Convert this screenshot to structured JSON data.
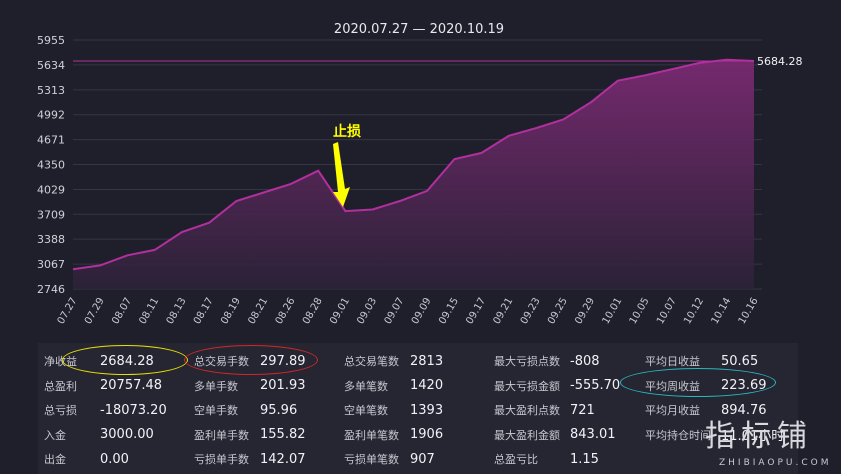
{
  "chart_data": {
    "type": "area",
    "title": "2020.07.27 — 2020.10.19",
    "x": [
      "07.27",
      "07.29",
      "08.07",
      "08.11",
      "08.13",
      "08.17",
      "08.19",
      "08.21",
      "08.26",
      "08.28",
      "09.01",
      "09.03",
      "09.07",
      "09.09",
      "09.15",
      "09.17",
      "09.21",
      "09.23",
      "09.25",
      "09.29",
      "10.01",
      "10.05",
      "10.07",
      "10.12",
      "10.14",
      "10.16"
    ],
    "y": [
      3000,
      3050,
      3180,
      3250,
      3480,
      3600,
      3880,
      3990,
      4100,
      4270,
      3750,
      3770,
      3880,
      4010,
      4420,
      4500,
      4720,
      4820,
      4930,
      5150,
      5430,
      5500,
      5580,
      5660,
      5700,
      5684.28
    ],
    "ylim": [
      2746,
      5955
    ],
    "yticks": [
      2746,
      3067,
      3388,
      3709,
      4029,
      4350,
      4671,
      4992,
      5313,
      5634,
      5955
    ],
    "last_value_label": "5684.28",
    "color": "#b1309e",
    "annotation": {
      "text": "止损",
      "color": "#ffff00",
      "at_x": "09.01"
    }
  },
  "stats": {
    "col1": [
      {
        "label": "净收益",
        "value": "2684.28"
      },
      {
        "label": "总盈利",
        "value": "20757.48"
      },
      {
        "label": "总亏损",
        "value": "-18073.20"
      },
      {
        "label": "入金",
        "value": "3000.00"
      },
      {
        "label": "出金",
        "value": "0.00"
      }
    ],
    "col2": [
      {
        "label": "总交易手数",
        "value": "297.89"
      },
      {
        "label": "多单手数",
        "value": "201.93"
      },
      {
        "label": "空单手数",
        "value": "95.96"
      },
      {
        "label": "盈利单手数",
        "value": "155.82"
      },
      {
        "label": "亏损单手数",
        "value": "142.07"
      }
    ],
    "col3": [
      {
        "label": "总交易笔数",
        "value": "2813"
      },
      {
        "label": "多单笔数",
        "value": "1420"
      },
      {
        "label": "空单笔数",
        "value": "1393"
      },
      {
        "label": "盈利单笔数",
        "value": "1906"
      },
      {
        "label": "亏损单笔数",
        "value": "907"
      }
    ],
    "col4": [
      {
        "label": "最大亏损点数",
        "value": "-808"
      },
      {
        "label": "最大亏损金额",
        "value": "-555.70"
      },
      {
        "label": "最大盈利点数",
        "value": "721"
      },
      {
        "label": "最大盈利金额",
        "value": "843.01"
      },
      {
        "label": "总盈亏比",
        "value": "1.15"
      }
    ],
    "col5": [
      {
        "label": "平均日收益",
        "value": "50.65"
      },
      {
        "label": "平均周收益",
        "value": "223.69"
      },
      {
        "label": "平均月收益",
        "value": "894.76"
      },
      {
        "label": "平均持仓时间",
        "value": "11.01小时"
      }
    ]
  },
  "highlight_colors": {
    "yellow": "#e8e000",
    "red": "#d02828",
    "cyan": "#28b8c0"
  },
  "watermark": {
    "cn": "指标铺",
    "en": "ZHIBIAOPU.COM"
  }
}
